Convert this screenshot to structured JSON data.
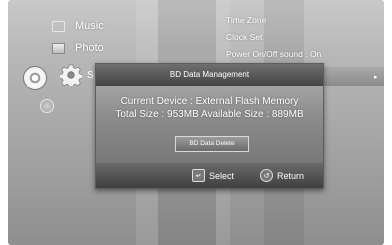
{
  "left_menu": {
    "items": [
      {
        "label": "Music",
        "icon": "music-icon"
      },
      {
        "label": "Photo",
        "icon": "photo-icon"
      }
    ],
    "disc_label": "DVD",
    "hidden_label_partial": "S"
  },
  "right_menu": {
    "items": [
      {
        "label": "Time Zone"
      },
      {
        "label": "Clock Set"
      },
      {
        "label": "Power On/Off sound :  On"
      }
    ],
    "selected_arrow": "▸"
  },
  "dialog": {
    "title": "BD Data Management",
    "current_device": "Current Device : External Flash Memory",
    "sizes": "Total Size : 953MB    Available Size : 889MB",
    "delete_button": "BD Data Delete",
    "footer": {
      "select_label": "Select",
      "return_label": "Return"
    }
  },
  "icons": [
    "disc-icon",
    "gear-icon",
    "globe-icon",
    "enter-key-icon",
    "return-key-icon"
  ]
}
